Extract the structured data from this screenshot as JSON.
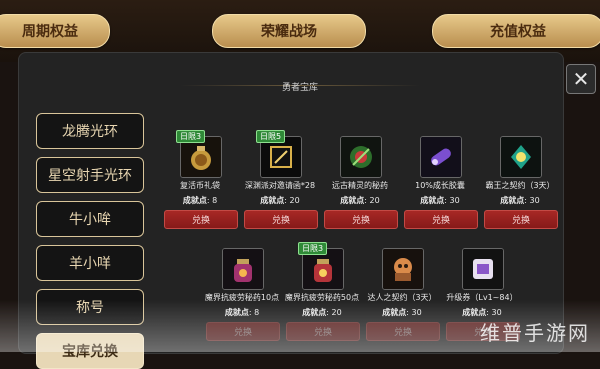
{
  "top_tabs": [
    "周期权益",
    "荣耀战场",
    "充值权益"
  ],
  "treasury_title": "勇者宝库",
  "close_label": "✕",
  "sidebar": [
    {
      "label": "龙腾光环"
    },
    {
      "label": "星空射手光环"
    },
    {
      "label": "牛小哞"
    },
    {
      "label": "羊小咩"
    },
    {
      "label": "称号"
    },
    {
      "label": "宝库兑换"
    }
  ],
  "items": [
    {
      "tag": "日限3",
      "name": "复活币礼袋",
      "points_label": "成就点",
      "points": ": 8",
      "button": "兑换"
    },
    {
      "tag": "日限5",
      "name": "深渊派对邀请函*28",
      "points_label": "成就点",
      "points": ": 20",
      "button": "兑换"
    },
    {
      "tag": "",
      "name": "远古精灵的秘药",
      "points_label": "成就点",
      "points": ": 20",
      "button": "兑换"
    },
    {
      "tag": "",
      "name": "10%成长胶囊",
      "points_label": "成就点",
      "points": ": 30",
      "button": "兑换"
    },
    {
      "tag": "",
      "name": "霸王之契约（3天）",
      "points_label": "成就点",
      "points": ": 30",
      "button": "兑换"
    },
    {
      "tag": "",
      "name": "魔界抗疲劳秘药10点",
      "points_label": "成就点",
      "points": ": 8",
      "button": "兑换"
    },
    {
      "tag": "日限3",
      "name": "魔界抗疲劳秘药50点",
      "points_label": "成就点",
      "points": ": 20",
      "button": "兑换"
    },
    {
      "tag": "",
      "name": "达人之契约（3天）",
      "points_label": "成就点",
      "points": ": 30",
      "button": "兑换"
    },
    {
      "tag": "",
      "name": "升级券（Lv1~84）",
      "points_label": "成就点",
      "points": ": 30",
      "button": "兑换"
    }
  ],
  "watermark": "维普手游网"
}
